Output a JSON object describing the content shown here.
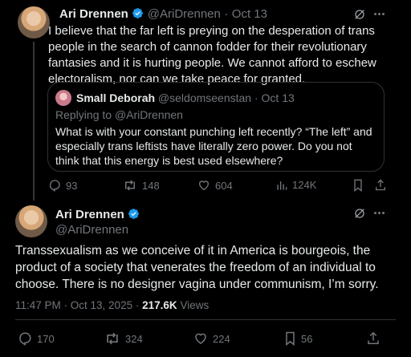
{
  "tweet1": {
    "name": "Ari Drennen",
    "handle": "@AriDrennen",
    "time": "Oct 13",
    "separator": "·",
    "text": "I believe that the far left is preying on the desperation of trans people in the search of cannon fodder for their revolutionary fantasies and it is hurting people. We cannot afford to eschew electoralism, nor can we take peace for granted.",
    "quote": {
      "name": "Small Deborah",
      "handle": "@seldomseenstan",
      "time": "Oct 13",
      "replying_prefix": "Replying to",
      "replying_to": "@AriDrennen",
      "text": "What is with your constant punching left recently? “The left” and especially trans leftists have literally zero power. Do you not think that this energy is best used elsewhere?"
    },
    "actions": {
      "replies": "93",
      "reposts": "148",
      "likes": "604",
      "views": "124K"
    }
  },
  "tweet2": {
    "name": "Ari Drennen",
    "handle": "@AriDrennen",
    "text": "Transsexualism as we conceive of it in America is bourgeois, the product of a society that venerates the freedom of an individual to choose. There is no designer vagina under communism, I’m sorry.",
    "timestamp": "11:47 PM · Oct 13, 2025",
    "separator": "·",
    "views_count": "217.6K",
    "views_label": "Views",
    "actions": {
      "replies": "170",
      "reposts": "324",
      "likes": "224",
      "bookmarks": "56"
    }
  },
  "colors": {
    "background": "#000000",
    "text": "#e7e9ea",
    "muted": "#71767b",
    "verified": "#1d9bf0",
    "border": "#2f3336"
  },
  "icons": [
    "verified-badge-icon",
    "grok-icon",
    "more-icon",
    "reply-icon",
    "repost-icon",
    "like-icon",
    "views-icon",
    "bookmark-icon",
    "share-icon"
  ]
}
